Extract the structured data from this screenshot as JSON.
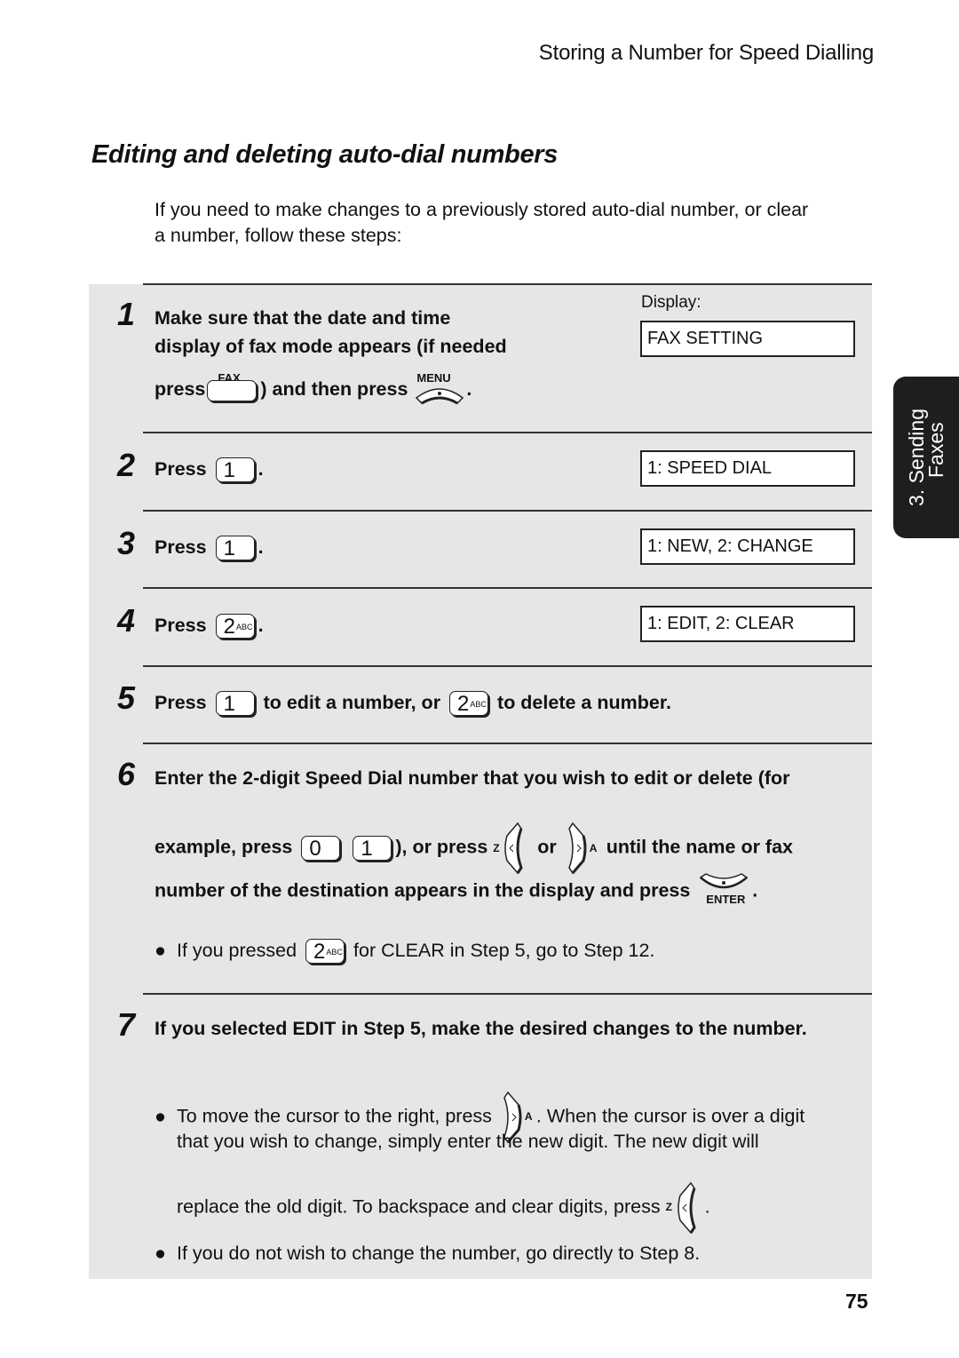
{
  "running_head": "Storing a Number for Speed Dialling",
  "section_title": "Editing and deleting auto-dial numbers",
  "intro": {
    "line1": "If you need to make changes to a previously stored auto-dial number, or clear",
    "line2": "a number, follow these steps:"
  },
  "display_label": "Display:",
  "side_tab": {
    "line1": "3. Sending",
    "line2": "Faxes"
  },
  "steps": [
    {
      "number": "1",
      "line1": "Make sure that the date and time",
      "line2": "display of fax mode appears (if needed",
      "line3_a": "press",
      "line3_b": ") and then press",
      "line3_c": ".",
      "fax_key_label": "FAX",
      "menu_key_label": "MENU",
      "display": "FAX SETTING"
    },
    {
      "number": "2",
      "text": "Press",
      "key": "1",
      "end": ".",
      "display": "1: SPEED DIAL"
    },
    {
      "number": "3",
      "text": "Press",
      "key": "1",
      "end": ".",
      "display": "1: NEW, 2: CHANGE"
    },
    {
      "number": "4",
      "text": "Press",
      "key": "2",
      "key_sub": "ABC",
      "end": ".",
      "display": "1: EDIT, 2: CLEAR"
    },
    {
      "number": "5",
      "text_a": "Press",
      "key1": "1",
      "text_b": "to edit a number, or",
      "key2": "2",
      "key2_sub": "ABC",
      "text_c": "to delete a number."
    },
    {
      "number": "6",
      "line1": "Enter the 2-digit Speed Dial number that you wish to edit or delete (for",
      "line2_a": "example, press",
      "key_a": "0",
      "key_b": "1",
      "line2_b": "), or press",
      "left_key_letter": "Z",
      "line2_c": "or",
      "right_key_letter": "A",
      "line2_d": "until the name or fax",
      "line3": "number of the destination appears in the display and press",
      "enter_key_label": "ENTER",
      "line3_end": ".",
      "bullet_a": "If you pressed",
      "bullet_key": "2",
      "bullet_key_sub": "ABC",
      "bullet_b": "for CLEAR in Step 5, go to Step 12."
    },
    {
      "number": "7",
      "line1": "If you selected EDIT in Step 5, make the desired changes to the number.",
      "bullet1_a": "To move the cursor to the right, press",
      "right_key_letter": "A",
      "bullet1_b": ". When the cursor is over a digit",
      "bullet1_line2": "that you wish to change, simply enter the new digit. The new digit will",
      "bullet1_line3": "replace the old digit. To backspace and clear digits, press",
      "left_key_letter": "Z",
      "bullet1_end": ".",
      "bullet2": "If you do not wish to change the number, go directly to Step 8."
    }
  ],
  "page_number": "75"
}
